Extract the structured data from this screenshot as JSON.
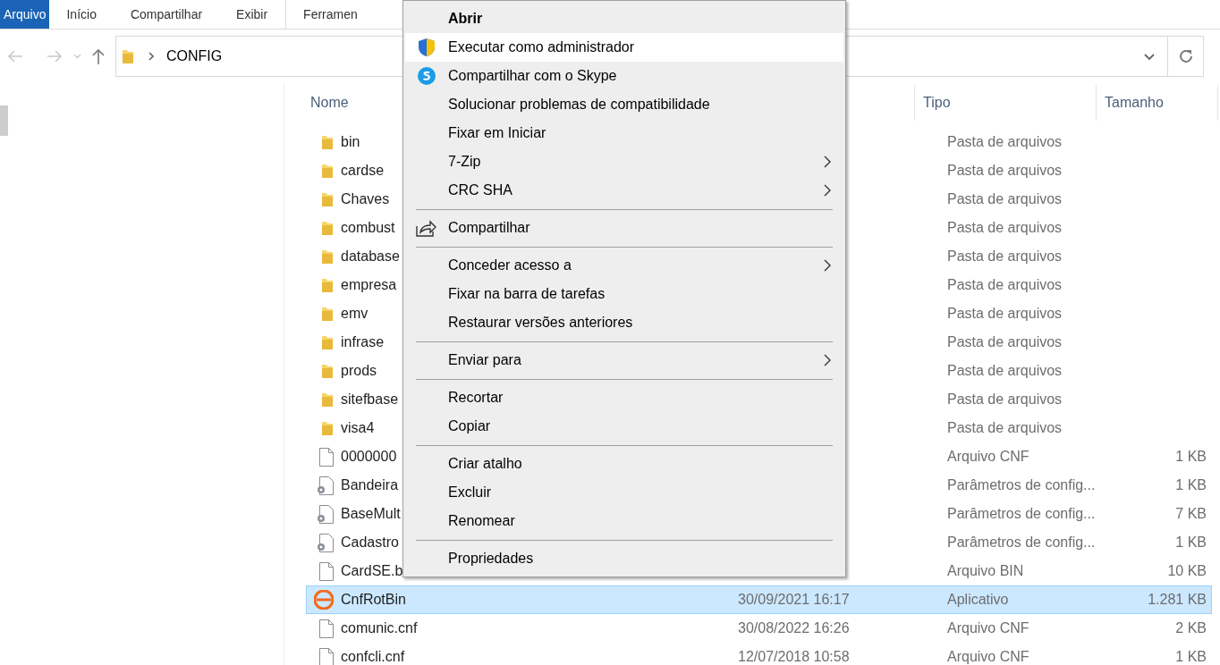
{
  "ribbon_tabs": [
    {
      "label": "Arquivo",
      "selected": true
    },
    {
      "label": "Início",
      "selected": false
    },
    {
      "label": "Compartilhar",
      "selected": false
    },
    {
      "label": "Exibir",
      "selected": false
    },
    {
      "label": "Ferramen",
      "selected": false
    }
  ],
  "address": {
    "path": [
      "CONFIG"
    ]
  },
  "columns": {
    "name": "Nome",
    "type": "Tipo",
    "size": "Tamanho"
  },
  "rows": [
    {
      "kind": "folder",
      "name": "bin",
      "type": "Pasta de arquivos",
      "selected": false
    },
    {
      "kind": "folder",
      "name": "cardse",
      "type": "Pasta de arquivos",
      "selected": false
    },
    {
      "kind": "folder",
      "name": "Chaves",
      "type": "Pasta de arquivos",
      "selected": false
    },
    {
      "kind": "folder",
      "name": "combust",
      "type": "Pasta de arquivos",
      "selected": false
    },
    {
      "kind": "folder",
      "name": "database",
      "type": "Pasta de arquivos",
      "selected": false
    },
    {
      "kind": "folder",
      "name": "empresa",
      "type": "Pasta de arquivos",
      "selected": false
    },
    {
      "kind": "folder",
      "name": "emv",
      "type": "Pasta de arquivos",
      "selected": false
    },
    {
      "kind": "folder",
      "name": "infrase",
      "type": "Pasta de arquivos",
      "selected": false
    },
    {
      "kind": "folder",
      "name": "prods",
      "type": "Pasta de arquivos",
      "selected": false
    },
    {
      "kind": "folder",
      "name": "sitefbase",
      "type": "Pasta de arquivos",
      "selected": false
    },
    {
      "kind": "folder",
      "name": "visa4",
      "type": "Pasta de arquivos",
      "selected": false
    },
    {
      "kind": "file",
      "name": "0000000",
      "type": "Arquivo CNF",
      "size": "1 KB",
      "selected": false
    },
    {
      "kind": "config",
      "name": "Bandeira",
      "type": "Parâmetros de config...",
      "size": "1 KB",
      "selected": false
    },
    {
      "kind": "config",
      "name": "BaseMult",
      "type": "Parâmetros de config...",
      "size": "7 KB",
      "selected": false
    },
    {
      "kind": "config",
      "name": "Cadastro",
      "type": "Parâmetros de config...",
      "size": "1 KB",
      "selected": false
    },
    {
      "kind": "file",
      "name": "CardSE.b",
      "type": "Arquivo BIN",
      "size": "10 KB",
      "selected": false
    },
    {
      "kind": "app",
      "name": "CnfRotBin",
      "date": "30/09/2021 16:17",
      "type": "Aplicativo",
      "size": "1.281 KB",
      "selected": true
    },
    {
      "kind": "file",
      "name": "comunic.cnf",
      "date": "30/08/2022 16:26",
      "type": "Arquivo CNF",
      "size": "2 KB",
      "selected": false
    },
    {
      "kind": "file",
      "name": "confcli.cnf",
      "date": "12/07/2018 10:58",
      "type": "Arquivo CNF",
      "size": "1 KB",
      "selected": false
    }
  ],
  "context_menu": [
    {
      "kind": "item",
      "label": "Abrir",
      "bold": true,
      "highlighted": false
    },
    {
      "kind": "shield",
      "label": "Executar como administrador",
      "highlighted": true
    },
    {
      "kind": "skype",
      "label": "Compartilhar com o Skype",
      "highlighted": false
    },
    {
      "kind": "item",
      "label": "Solucionar problemas de compatibilidade",
      "highlighted": false
    },
    {
      "kind": "item",
      "label": "Fixar em Iniciar",
      "highlighted": false
    },
    {
      "kind": "item",
      "label": "7-Zip",
      "submenu": true,
      "highlighted": false
    },
    {
      "kind": "item",
      "label": "CRC SHA",
      "submenu": true,
      "highlighted": false
    },
    {
      "kind": "separator"
    },
    {
      "kind": "share",
      "label": "Compartilhar",
      "highlighted": false
    },
    {
      "kind": "separator"
    },
    {
      "kind": "item",
      "label": "Conceder acesso a",
      "submenu": true,
      "highlighted": false
    },
    {
      "kind": "item",
      "label": "Fixar na barra de tarefas",
      "highlighted": false
    },
    {
      "kind": "item",
      "label": "Restaurar versões anteriores",
      "highlighted": false
    },
    {
      "kind": "separator"
    },
    {
      "kind": "item",
      "label": "Enviar para",
      "submenu": true,
      "highlighted": false
    },
    {
      "kind": "separator"
    },
    {
      "kind": "item",
      "label": "Recortar",
      "highlighted": false
    },
    {
      "kind": "item",
      "label": "Copiar",
      "highlighted": false
    },
    {
      "kind": "separator"
    },
    {
      "kind": "item",
      "label": "Criar atalho",
      "highlighted": false
    },
    {
      "kind": "item",
      "label": "Excluir",
      "highlighted": false
    },
    {
      "kind": "item",
      "label": "Renomear",
      "highlighted": false
    },
    {
      "kind": "separator"
    },
    {
      "kind": "item",
      "label": "Propriedades",
      "highlighted": false
    }
  ]
}
